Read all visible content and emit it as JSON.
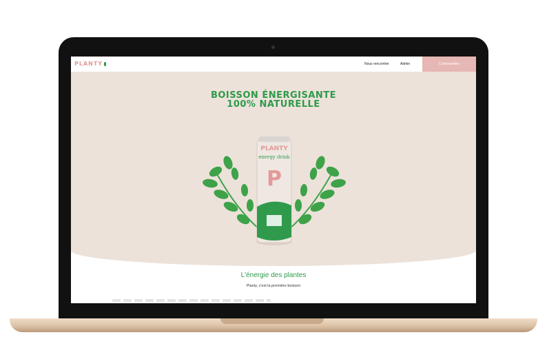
{
  "nav": {
    "logo": "PLANTY",
    "links": [
      "Nous rencontrer",
      "Admin"
    ],
    "cta": "Commander"
  },
  "hero": {
    "title_line1": "BOISSON ÉNERGISANTE",
    "title_line2": "100% NATURELLE",
    "can": {
      "brand": "PLANTY",
      "subtitle": "energy drink",
      "letter": "P"
    }
  },
  "section": {
    "title": "L'énergie des plantes",
    "text": "Planty, c'est la première boisson"
  },
  "colors": {
    "accent_green": "#2e9a4a",
    "accent_pink": "#e6b7b4",
    "hero_bg": "#ece2da"
  }
}
